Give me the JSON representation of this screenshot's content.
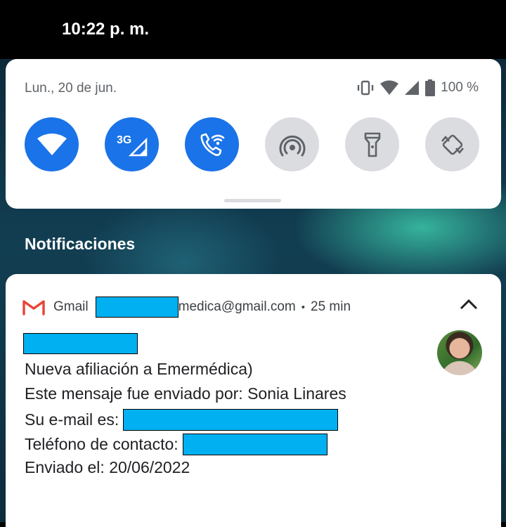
{
  "status_bar": {
    "time": "10:22 p. m."
  },
  "quick_settings": {
    "date": "Lun., 20 de jun.",
    "battery": "100 %",
    "tiles": [
      {
        "name": "wifi",
        "icon": "wifi-icon",
        "active": true
      },
      {
        "name": "mobile-data",
        "icon": "3g-signal-icon",
        "label": "3G",
        "active": true
      },
      {
        "name": "wifi-calling",
        "icon": "wifi-calling-icon",
        "active": true
      },
      {
        "name": "hotspot",
        "icon": "hotspot-icon",
        "active": false
      },
      {
        "name": "flashlight",
        "icon": "flashlight-icon",
        "active": false
      },
      {
        "name": "auto-rotate",
        "icon": "auto-rotate-icon",
        "active": false
      }
    ]
  },
  "notifications": {
    "header": "Notificaciones",
    "items": [
      {
        "app": "Gmail",
        "account_suffix": "medica@gmail.com",
        "separator": "•",
        "time": "25 min",
        "subject": "Nueva afiliación a Emermédica)",
        "line_sender": "Este mensaje fue enviado por: Sonia Linares",
        "line_email_label": "Su e-mail es:",
        "line_phone_label": "Teléfono de contacto:",
        "line_date": "Enviado el: 20/06/2022"
      }
    ]
  },
  "colors": {
    "tile_active": "#1a73e8",
    "tile_inactive": "#dadce0",
    "redaction": "#00b0f0"
  }
}
